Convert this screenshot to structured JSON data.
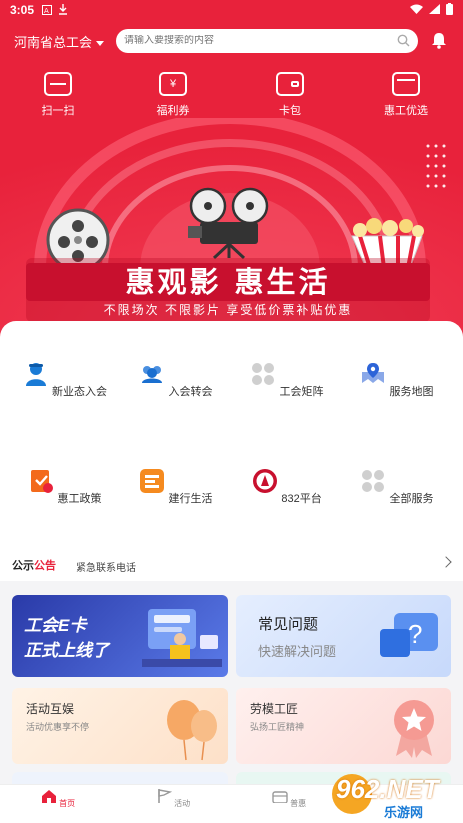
{
  "status": {
    "time": "3:05"
  },
  "header": {
    "region": "河南省总工会",
    "search_placeholder": "请输入要搜索的内容"
  },
  "quick": [
    {
      "label": "扫一扫"
    },
    {
      "label": "福利券"
    },
    {
      "label": "卡包"
    },
    {
      "label": "惠工优选"
    }
  ],
  "banner": {
    "title": "惠观影 惠生活",
    "subtitle": "不限场次 不限影片 享受低价票补贴优惠"
  },
  "services": [
    {
      "label": "新业态入会"
    },
    {
      "label": "入会转会"
    },
    {
      "label": "工会矩阵"
    },
    {
      "label": "服务地图"
    },
    {
      "label": "惠工政策"
    },
    {
      "label": "建行生活"
    },
    {
      "label": "832平台"
    },
    {
      "label": "全部服务"
    }
  ],
  "notice": {
    "tag_a": "公示",
    "tag_b": "公告",
    "text": "紧急联系电话"
  },
  "cards": {
    "ecard": {
      "line1": "工会E卡",
      "line2": "正式上线了"
    },
    "faq": {
      "title": "常见问题",
      "subtitle": "快速解决问题"
    },
    "activity": {
      "title": "活动互娱",
      "subtitle": "活动优惠享不停"
    },
    "labor": {
      "title": "劳模工匠",
      "subtitle": "弘扬工匠精神"
    }
  },
  "tabs": [
    {
      "label": "首页"
    },
    {
      "label": "活动"
    },
    {
      "label": "普惠"
    }
  ],
  "watermark": {
    "brand": "962.NET",
    "sub": "乐游网"
  },
  "colors": {
    "brand_red": "#e8223b",
    "banner_dark": "#c8102e"
  }
}
